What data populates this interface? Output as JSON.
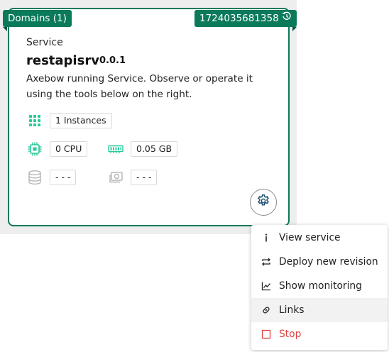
{
  "card": {
    "domains_tag": "Domains (1)",
    "id_tag": "1724035681358",
    "kind": "Service",
    "name": "restapisrv",
    "version": "0.0.1",
    "description": "Axebow running Service. Observe or operate it using the tools below on the right.",
    "metrics": {
      "instances": "1 Instances",
      "cpu": "0 CPU",
      "memory": "0.05 GB",
      "storage": "- - -",
      "volume": "- - -"
    }
  },
  "colors": {
    "accent": "#0b7a5a",
    "icon_green": "#27c99a",
    "danger": "#e0403f",
    "muted_icon": "#b5b5b5"
  },
  "menu": {
    "items": [
      {
        "label": "View service",
        "icon": "info-icon"
      },
      {
        "label": "Deploy new revision",
        "icon": "swap-arrows-icon"
      },
      {
        "label": "Show monitoring",
        "icon": "line-chart-icon"
      },
      {
        "label": "Links",
        "icon": "link-icon"
      },
      {
        "label": "Stop",
        "icon": "stop-square-icon"
      }
    ]
  }
}
